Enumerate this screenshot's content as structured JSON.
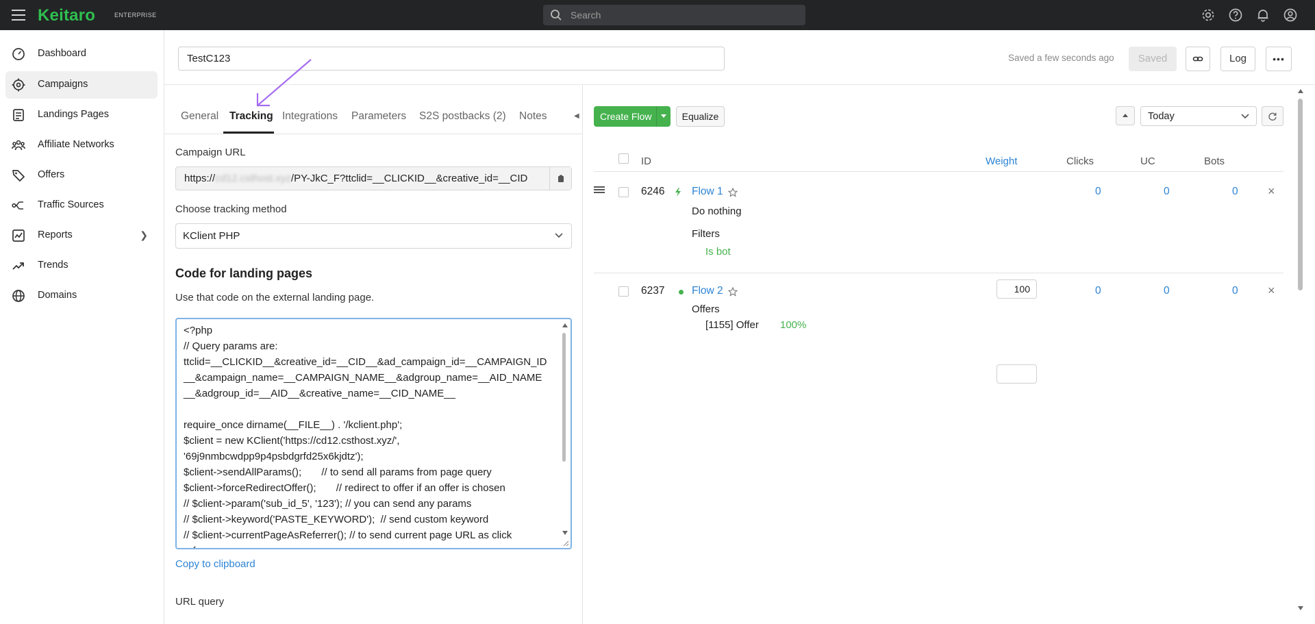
{
  "app": {
    "logo": "Keitaro",
    "edition": "ENTERPRISE",
    "search_placeholder": "Search"
  },
  "sidebar": {
    "items": [
      {
        "label": "Dashboard",
        "icon": "dashboard-icon"
      },
      {
        "label": "Campaigns",
        "icon": "target-icon",
        "active": true
      },
      {
        "label": "Landings Pages",
        "icon": "landing-page-icon"
      },
      {
        "label": "Affiliate Networks",
        "icon": "network-icon"
      },
      {
        "label": "Offers",
        "icon": "tag-icon"
      },
      {
        "label": "Traffic Sources",
        "icon": "traffic-source-icon"
      },
      {
        "label": "Reports",
        "icon": "chart-icon",
        "has_children": true
      },
      {
        "label": "Trends",
        "icon": "trend-icon"
      },
      {
        "label": "Domains",
        "icon": "globe-icon"
      }
    ]
  },
  "header": {
    "campaign_name": "TestC123",
    "save_status": "Saved a few seconds ago",
    "saved_label": "Saved",
    "log_label": "Log"
  },
  "tabs": [
    "General",
    "Tracking",
    "Integrations",
    "Parameters",
    "S2S postbacks (2)",
    "Notes"
  ],
  "tracking": {
    "campaign_url_label": "Campaign URL",
    "campaign_url_prefix": "https://",
    "campaign_url_host": "cd12.csthost.xyz",
    "campaign_url_suffix": "/PY-JkC_F?ttclid=__CLICKID__&creative_id=__CID",
    "method_label": "Choose tracking method",
    "method_value": "KClient PHP",
    "code_title": "Code for landing pages",
    "code_desc": "Use that code on the external landing page.",
    "code_lines": [
      "<?php",
      "// Query params are:",
      "ttclid=__CLICKID__&creative_id=__CID__&ad_campaign_id=__CAMPAIGN_ID",
      "__&campaign_name=__CAMPAIGN_NAME__&adgroup_name=__AID_NAME",
      "__&adgroup_id=__AID__&creative_name=__CID_NAME__",
      "",
      "require_once dirname(__FILE__) . '/kclient.php';",
      "$client = new KClient('https://cd12.csthost.xyz/',",
      "'69j9nmbcwdpp9p4psbdgrfd25x6kjdtz');",
      "$client->sendAllParams();       // to send all params from page query",
      "$client->forceRedirectOffer();       // redirect to offer if an offer is chosen",
      "// $client->param('sub_id_5', '123'); // you can send any params",
      "// $client->keyword('PASTE_KEYWORD');  // send custom keyword",
      "// $client->currentPageAsReferrer(); // to send current page URL as click",
      "referrer"
    ],
    "copy_label": "Copy to clipboard",
    "url_query_label": "URL query"
  },
  "flows_toolbar": {
    "create_label": "Create Flow",
    "equalize_label": "Equalize",
    "date_range": "Today"
  },
  "flows_table": {
    "headers": {
      "id": "ID",
      "weight": "Weight",
      "clicks": "Clicks",
      "uc": "UC",
      "bots": "Bots"
    },
    "rows": [
      {
        "id": "6246",
        "name": "Flow 1",
        "action": "Do nothing",
        "section_label": "Filters",
        "detail": "Is bot",
        "clicks": "0",
        "uc": "0",
        "bots": "0"
      },
      {
        "id": "6237",
        "name": "Flow 2",
        "weight": "100",
        "section_label": "Offers",
        "detail": "[1155] Offer",
        "detail_pct": "100%",
        "clicks": "0",
        "uc": "0",
        "bots": "0"
      }
    ]
  },
  "colors": {
    "brand": "#2fbf4f",
    "link": "#2d84d4",
    "create_button": "#45b24e",
    "annotation_arrow": "#a56cf0"
  }
}
